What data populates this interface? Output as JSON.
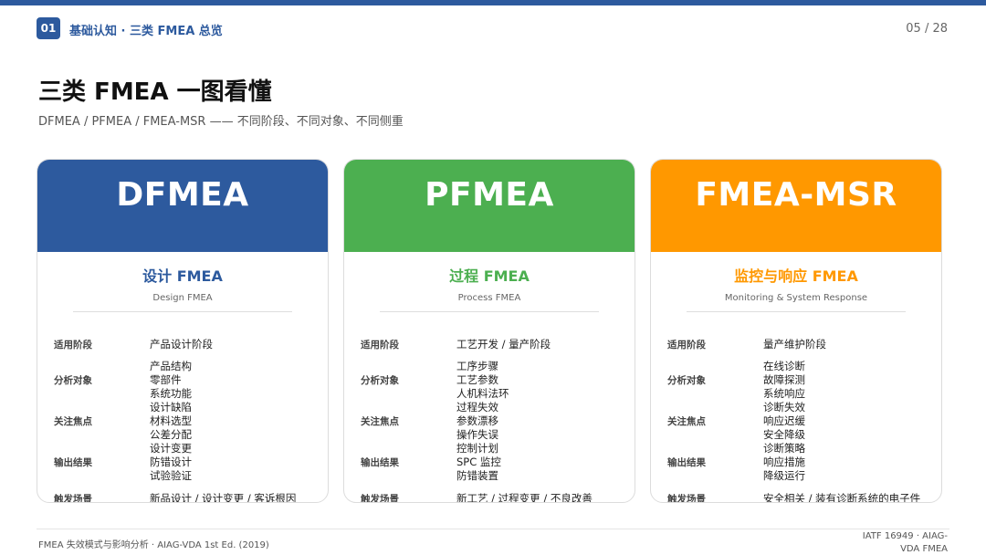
{
  "header": {
    "section_no": "01",
    "section_title": "基础认知 · 三类 FMEA 总览",
    "page": "05 / 28"
  },
  "title": "三类 FMEA 一图看懂",
  "subtitle": "DFMEA / PFMEA / FMEA-MSR —— 不同阶段、不同对象、不同侧重",
  "colors": {
    "header_bar": "#2d5a9e",
    "dfmea": "#2d5a9e",
    "pfmea": "#4caf50",
    "msr": "#ff9800"
  },
  "cards": [
    {
      "title": "DFMEA",
      "cn_name": "设计 FMEA",
      "en_name": "Design FMEA",
      "rows": [
        {
          "label": "适用阶段",
          "value": "产品设计阶段"
        },
        {
          "label": "分析对象",
          "value": "产品结构\n零部件\n系统功能"
        },
        {
          "label": "关注焦点",
          "value": "设计缺陷\n材料选型\n公差分配"
        },
        {
          "label": "输出结果",
          "value": "设计变更\n防错设计\n试验验证"
        },
        {
          "label": "触发场景",
          "value": "新品设计 / 设计变更 / 客诉根因"
        }
      ]
    },
    {
      "title": "PFMEA",
      "cn_name": "过程 FMEA",
      "en_name": "Process FMEA",
      "rows": [
        {
          "label": "适用阶段",
          "value": "工艺开发 / 量产阶段"
        },
        {
          "label": "分析对象",
          "value": "工序步骤\n工艺参数\n人机料法环"
        },
        {
          "label": "关注焦点",
          "value": "过程失效\n参数漂移\n操作失误"
        },
        {
          "label": "输出结果",
          "value": "控制计划\nSPC 监控\n防错装置"
        },
        {
          "label": "触发场景",
          "value": "新工艺 / 过程变更 / 不良改善"
        }
      ]
    },
    {
      "title": "FMEA-MSR",
      "cn_name": "监控与响应 FMEA",
      "en_name": "Monitoring & System Response",
      "rows": [
        {
          "label": "适用阶段",
          "value": "量产维护阶段"
        },
        {
          "label": "分析对象",
          "value": "在线诊断\n故障探测\n系统响应"
        },
        {
          "label": "关注焦点",
          "value": "诊断失效\n响应迟缓\n安全降级"
        },
        {
          "label": "输出结果",
          "value": "诊断策略\n响应措施\n降级运行"
        },
        {
          "label": "触发场景",
          "value": "安全相关 / 装有诊断系统的电子件"
        }
      ]
    }
  ],
  "footer": {
    "left": "FMEA 失效模式与影响分析 · AIAG-VDA 1st Ed. (2019)",
    "right": "IATF 16949 · AIAG-VDA FMEA"
  }
}
